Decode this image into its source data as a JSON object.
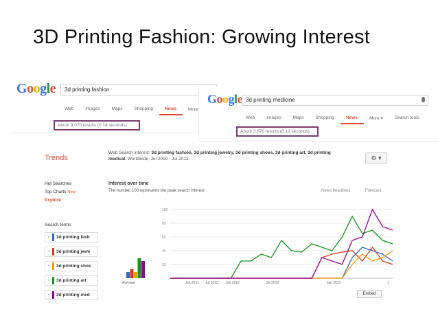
{
  "slide": {
    "title": "3D Printing Fashion: Growing Interest"
  },
  "google_1": {
    "logo": [
      "G",
      "o",
      "o",
      "g",
      "l",
      "e"
    ],
    "query": "3d printing fashion",
    "nav": [
      "Web",
      "Images",
      "Maps",
      "Shopping",
      "News",
      "More ▾"
    ],
    "active_tab": "News",
    "stats": "About 9,070 results (0.14 seconds)"
  },
  "google_2": {
    "logo": [
      "G",
      "o",
      "o",
      "g",
      "l",
      "e"
    ],
    "query": "3d printing medicine",
    "nav": [
      "Web",
      "Images",
      "Maps",
      "Shopping",
      "News",
      "More ▾",
      "Search tools"
    ],
    "active_tab": "News",
    "stats": "About 3,670 results (0.12 seconds)"
  },
  "trends": {
    "logo": "Trends",
    "desc_prefix": "Web Search interest:",
    "desc_terms": "3d printing fashion, 3d printing jewelry, 3d printing shoes, 3d printing art, 3d printing medical",
    "desc_suffix": ". Worldwide, Jul 2010 - Jul 2013.",
    "gear": "⚙ ▾",
    "sidenav": {
      "hot": "Hot Searches",
      "top": "Top Charts",
      "new": "New!",
      "explore": "Explore"
    },
    "terms_head": "Search terms",
    "terms": [
      {
        "label": "3d printing fash",
        "color": "#3366cc"
      },
      {
        "label": "3d printing jewé",
        "color": "#dc3912"
      },
      {
        "label": "3d printing shoe",
        "color": "#ff9900"
      },
      {
        "label": "3d printing art",
        "color": "#109618"
      },
      {
        "label": "3d printing med",
        "color": "#990099"
      }
    ],
    "iot_title": "Interest over time",
    "iot_sub": "The number 100 represents the peak search interest",
    "news_headlines": "News headlines",
    "forecast": "Forecast",
    "embed": "Embed"
  },
  "chart_data": {
    "type": "line",
    "title": "Interest over time",
    "ylim": [
      0,
      100
    ],
    "yticks": [
      20,
      40,
      60,
      80,
      100
    ],
    "xticks": [
      "Jan 2011",
      "Jul 2011",
      "Jan 2012",
      "Jul 2012",
      "Jan 2013",
      "J"
    ],
    "average_label": "Average",
    "averages": [
      {
        "name": "3d printing fashion",
        "value": 9
      },
      {
        "name": "3d printing jewelry",
        "value": 13
      },
      {
        "name": "3d printing shoes",
        "value": 9
      },
      {
        "name": "3d printing art",
        "value": 29
      },
      {
        "name": "3d printing medical",
        "value": 25
      }
    ],
    "x": [
      "Jul 2010",
      "Oct 2010",
      "Jan 2011",
      "Apr 2011",
      "Jul 2011",
      "Oct 2011",
      "Jan 2012",
      "Feb 2012",
      "Apr 2012",
      "May 2012",
      "Jul 2012",
      "Aug 2012",
      "Sep 2012",
      "Oct 2012",
      "Nov 2012",
      "Dec 2012",
      "Jan 2013",
      "Feb 2013",
      "Mar 2013",
      "Apr 2013",
      "May 2013",
      "Jun 2013",
      "Jul 2013"
    ],
    "series": [
      {
        "name": "3d printing fashion",
        "color": "#3366cc",
        "values": [
          0,
          0,
          0,
          0,
          0,
          0,
          0,
          0,
          0,
          0,
          0,
          0,
          0,
          0,
          0,
          0,
          0,
          0,
          30,
          45,
          40,
          35,
          25
        ]
      },
      {
        "name": "3d printing jewelry",
        "color": "#dc3912",
        "values": [
          0,
          0,
          0,
          0,
          0,
          0,
          0,
          0,
          0,
          0,
          0,
          0,
          0,
          0,
          0,
          30,
          35,
          38,
          40,
          25,
          45,
          25,
          20
        ]
      },
      {
        "name": "3d printing shoes",
        "color": "#ff9900",
        "values": [
          0,
          0,
          0,
          0,
          0,
          0,
          0,
          0,
          0,
          0,
          0,
          0,
          0,
          0,
          0,
          0,
          0,
          0,
          20,
          35,
          25,
          30,
          40
        ]
      },
      {
        "name": "3d printing art",
        "color": "#109618",
        "values": [
          0,
          0,
          0,
          0,
          0,
          0,
          0,
          25,
          25,
          35,
          30,
          55,
          40,
          38,
          50,
          45,
          40,
          60,
          90,
          65,
          70,
          55,
          50
        ]
      },
      {
        "name": "3d printing medical",
        "color": "#990099",
        "values": [
          0,
          0,
          0,
          0,
          0,
          0,
          0,
          0,
          0,
          0,
          0,
          0,
          0,
          0,
          0,
          30,
          25,
          20,
          55,
          60,
          100,
          75,
          70
        ]
      }
    ]
  }
}
